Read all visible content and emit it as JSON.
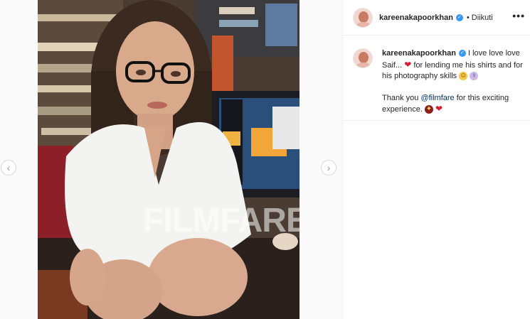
{
  "post": {
    "username": "kareenakapoorkhan",
    "follow_dot": "•",
    "follow_status": "Diikuti",
    "more_label": "•••",
    "caption": {
      "username": "kareenakapoorkhan",
      "line1_text": "I love love love Saif...",
      "line1_after_heart": "for lending me his shirts and for his photography skills",
      "line2_prefix": "Thank you",
      "mention": "@filmfare",
      "line2_suffix": "for this exciting experience."
    }
  },
  "media": {
    "watermark": "FILMFARE"
  },
  "carousel": {
    "prev_label": "‹",
    "next_label": "›"
  },
  "icons": {
    "verified": "verified-badge-icon",
    "heart": "red-heart-emoji",
    "rofl": "rofl-emoji",
    "woman": "woman-emoji",
    "party": "party-emoji"
  },
  "colors": {
    "verified_blue": "#3897f0",
    "heart_red": "#d81b30",
    "mention_blue": "#003569"
  }
}
